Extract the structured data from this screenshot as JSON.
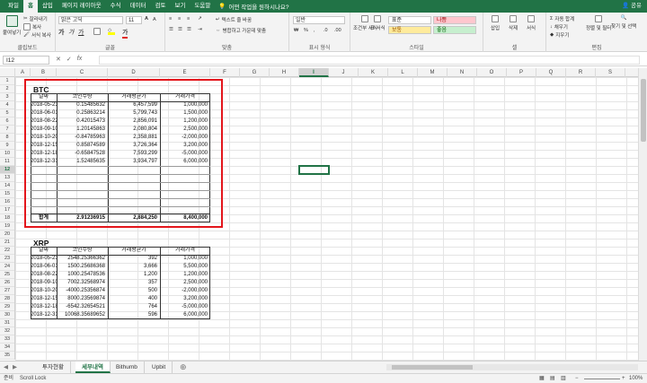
{
  "menu": {
    "tabs": [
      "파일",
      "홈",
      "삽입",
      "페이지 레이아웃",
      "수식",
      "데이터",
      "검토",
      "보기",
      "도움말"
    ],
    "active_index": 1,
    "tell_me": "어떤 작업을 원하시나요?",
    "share": "공유"
  },
  "ribbon": {
    "clipboard": {
      "paste": "붙여넣기",
      "cut": "잘라내기",
      "copy": "복사",
      "format_painter": "서식 복사",
      "label": "클립보드"
    },
    "font": {
      "name": "맑은 고딕",
      "size": "11",
      "label": "글꼴"
    },
    "alignment": {
      "wrap": "텍스트 줄 바꿈",
      "merge": "병합하고 가운데 맞춤",
      "label": "맞춤"
    },
    "number": {
      "format": "일반",
      "label": "표시 형식"
    },
    "styles": {
      "conditional": "조건부 서식",
      "table": "표 서식",
      "normal": "표준",
      "bad": "나쁨",
      "neutral": "보통",
      "good": "좋음",
      "label": "스타일"
    },
    "cells": {
      "insert": "삽입",
      "delete": "삭제",
      "format": "서식",
      "label": "셀"
    },
    "editing": {
      "autosum": "자동 합계",
      "fill": "채우기",
      "clear": "지우기",
      "sort": "정렬 및 필터",
      "find": "찾기 및 선택",
      "label": "편집"
    },
    "colors": {
      "bad_bg": "#ffc7ce",
      "bad_fg": "#9c0006",
      "neutral_bg": "#ffeb9c",
      "neutral_fg": "#9c5700",
      "good_bg": "#c6efce",
      "good_fg": "#006100"
    }
  },
  "formula_bar": {
    "name_box": "I12",
    "fx": "fx",
    "value": ""
  },
  "columns": [
    "A",
    "B",
    "C",
    "D",
    "E",
    "F",
    "G",
    "H",
    "I",
    "J",
    "K",
    "L",
    "M",
    "N",
    "O",
    "P",
    "Q",
    "R",
    "S"
  ],
  "selected_column": "I",
  "selected_row": 12,
  "rows": [
    1,
    2,
    3,
    4,
    5,
    6,
    7,
    8,
    9,
    10,
    11,
    12,
    13,
    14,
    15,
    16,
    17,
    18,
    19,
    20,
    21,
    22,
    23,
    24,
    25,
    26,
    27,
    28,
    29,
    30,
    31,
    32,
    33,
    34,
    35
  ],
  "btc": {
    "title": "BTC",
    "headers": [
      "날짜",
      "코인수량",
      "거래평균가",
      "거래가격"
    ],
    "rows": [
      [
        "2018-05-23",
        "0.15485632",
        "6,457,599",
        "1,000,000"
      ],
      [
        "2018-06-01",
        "0.25863214",
        "5,799,743",
        "1,500,000"
      ],
      [
        "2018-08-22",
        "0.42015473",
        "2,856,091",
        "1,200,000"
      ],
      [
        "2018-09-10",
        "1.20145863",
        "2,080,804",
        "2,500,000"
      ],
      [
        "2018-10-20",
        "-0.84785963",
        "2,358,881",
        "-2,000,000"
      ],
      [
        "2018-12-15",
        "0.85874589",
        "3,726,364",
        "3,200,000"
      ],
      [
        "2018-12-18",
        "-0.65847528",
        "7,593,299",
        "-5,000,000"
      ],
      [
        "2018-12-31",
        "1.52485635",
        "3,934,797",
        "6,000,000"
      ]
    ],
    "total": [
      "합계",
      "2.91236915",
      "2,884,250",
      "8,400,000"
    ]
  },
  "xrp": {
    "title": "XRP",
    "headers": [
      "날짜",
      "코인수량",
      "거래평균가",
      "거래가격"
    ],
    "rows": [
      [
        "2018-05-23",
        "2548.25366362",
        "392",
        "1,000,000"
      ],
      [
        "2018-06-01",
        "1500.25686368",
        "3,666",
        "5,500,000"
      ],
      [
        "2018-08-22",
        "1000.25478536",
        "1,200",
        "1,200,000"
      ],
      [
        "2018-09-10",
        "7002.32568974",
        "357",
        "2,500,000"
      ],
      [
        "2018-10-20",
        "-4000.25356874",
        "500",
        "-2,000,000"
      ],
      [
        "2018-12-15",
        "8000.23569874",
        "400",
        "3,200,000"
      ],
      [
        "2018-12-18",
        "-6542.32654521",
        "764",
        "-5,000,000"
      ],
      [
        "2018-12-31",
        "10068.35689652",
        "596",
        "6,000,000"
      ]
    ]
  },
  "sheets": [
    "투자현황",
    "세부내역",
    "Bithumb",
    "Upbit"
  ],
  "active_sheet": 1,
  "status": {
    "ready": "준비",
    "scroll_lock": "Scroll Lock",
    "zoom": "100%"
  }
}
